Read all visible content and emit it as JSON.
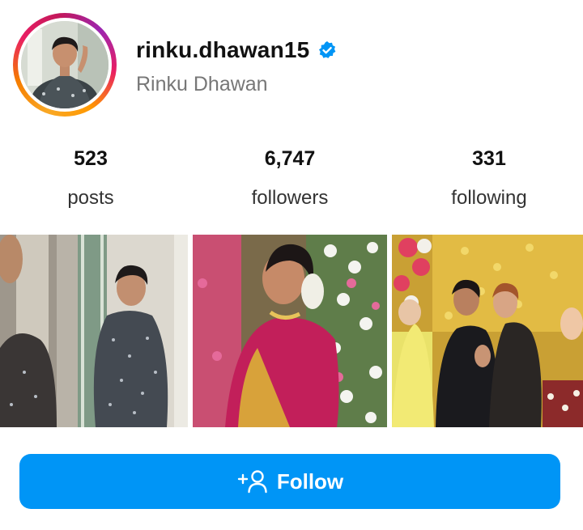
{
  "profile": {
    "username": "rinku.dhawan15",
    "full_name": "Rinku Dhawan",
    "verified": true
  },
  "stats": [
    {
      "value": "523",
      "label": "posts"
    },
    {
      "value": "6,747",
      "label": "followers"
    },
    {
      "value": "331",
      "label": "following"
    }
  ],
  "posts": [
    {
      "description": "woman in sequined dress in front of mirror"
    },
    {
      "description": "woman in pink saree with floral decor"
    },
    {
      "description": "group celebrating at a party with balloons"
    }
  ],
  "follow_button": {
    "label": "Follow",
    "icon": "add-person-icon"
  },
  "colors": {
    "accent": "#0095f6",
    "verified_badge": "#0095f6"
  }
}
